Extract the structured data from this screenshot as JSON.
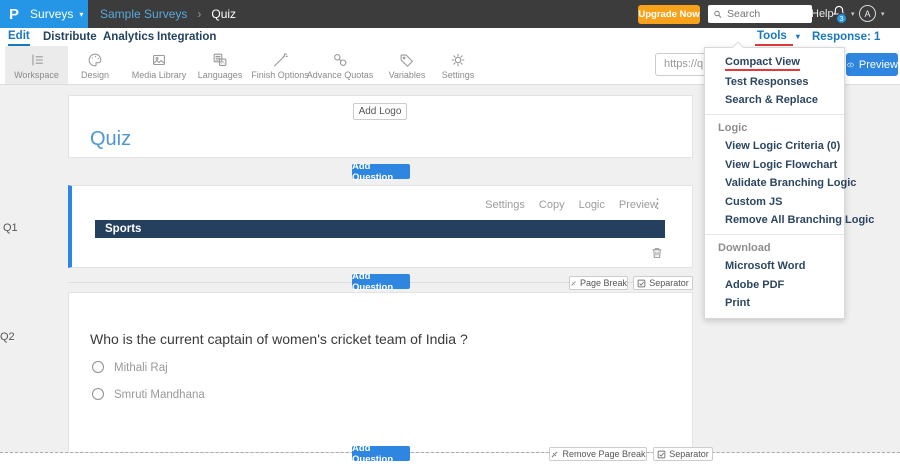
{
  "topbar": {
    "logo_glyph": "P",
    "product_label": "Surveys",
    "breadcrumb": [
      "Sample Surveys",
      "Quiz"
    ],
    "upgrade_label": "Upgrade Now",
    "search_placeholder": "Search",
    "help_label": "Help",
    "notification_count": "3",
    "avatar_initial": "A"
  },
  "nav": {
    "tabs": [
      {
        "label": "Edit"
      },
      {
        "label": "Distribute"
      },
      {
        "label": "Analytics"
      },
      {
        "label": "Integration"
      }
    ],
    "tools_label": "Tools",
    "response_label": "Response: 1"
  },
  "toolbar": {
    "tabs": [
      {
        "label": "Workspace"
      },
      {
        "label": "Design"
      },
      {
        "label": "Media Library"
      },
      {
        "label": "Languages"
      },
      {
        "label": "Finish Options"
      },
      {
        "label": "Advance Quotas"
      },
      {
        "label": "Variables"
      },
      {
        "label": "Settings"
      }
    ],
    "url_value": "https://q",
    "preview_label": "Preview"
  },
  "tools_menu": {
    "items": [
      {
        "type": "item",
        "label": "Compact View",
        "highlighted": true
      },
      {
        "type": "item",
        "label": "Test Responses"
      },
      {
        "type": "item",
        "label": "Search & Replace"
      },
      {
        "type": "divider"
      },
      {
        "type": "header",
        "label": "Logic"
      },
      {
        "type": "item",
        "label": "View Logic Criteria (0)"
      },
      {
        "type": "item",
        "label": "View Logic Flowchart"
      },
      {
        "type": "item",
        "label": "Validate Branching Logic"
      },
      {
        "type": "item",
        "label": "Custom JS"
      },
      {
        "type": "item",
        "label": "Remove All Branching Logic"
      },
      {
        "type": "divider"
      },
      {
        "type": "header",
        "label": "Download"
      },
      {
        "type": "item",
        "label": "Microsoft Word"
      },
      {
        "type": "item",
        "label": "Adobe PDF"
      },
      {
        "type": "item",
        "label": "Print"
      }
    ]
  },
  "canvas": {
    "add_logo_label": "Add Logo",
    "survey_title": "Quiz",
    "add_question_label": "Add Question",
    "q1": {
      "id": "Q1",
      "actions": [
        "Settings",
        "Copy",
        "Logic",
        "Preview"
      ],
      "block_title": "Sports"
    },
    "between": {
      "page_break_label": "Page Break",
      "separator_label": "Separator"
    },
    "q2": {
      "id": "Q2",
      "question": "Who is the current captain of women's cricket team of India ?",
      "options": [
        "Mithali Raj",
        "Smruti Mandhana"
      ]
    },
    "bottom": {
      "remove_page_break_label": "Remove Page Break",
      "separator_label": "Separator"
    }
  },
  "colors": {
    "accent_blue": "#2e86e0",
    "brand_blue": "#2595e6",
    "topbar_bg": "#3c3c3c",
    "upgrade_orange": "#f8a21c",
    "annotation_red": "#e03a3a",
    "block_navy": "#24405e"
  }
}
